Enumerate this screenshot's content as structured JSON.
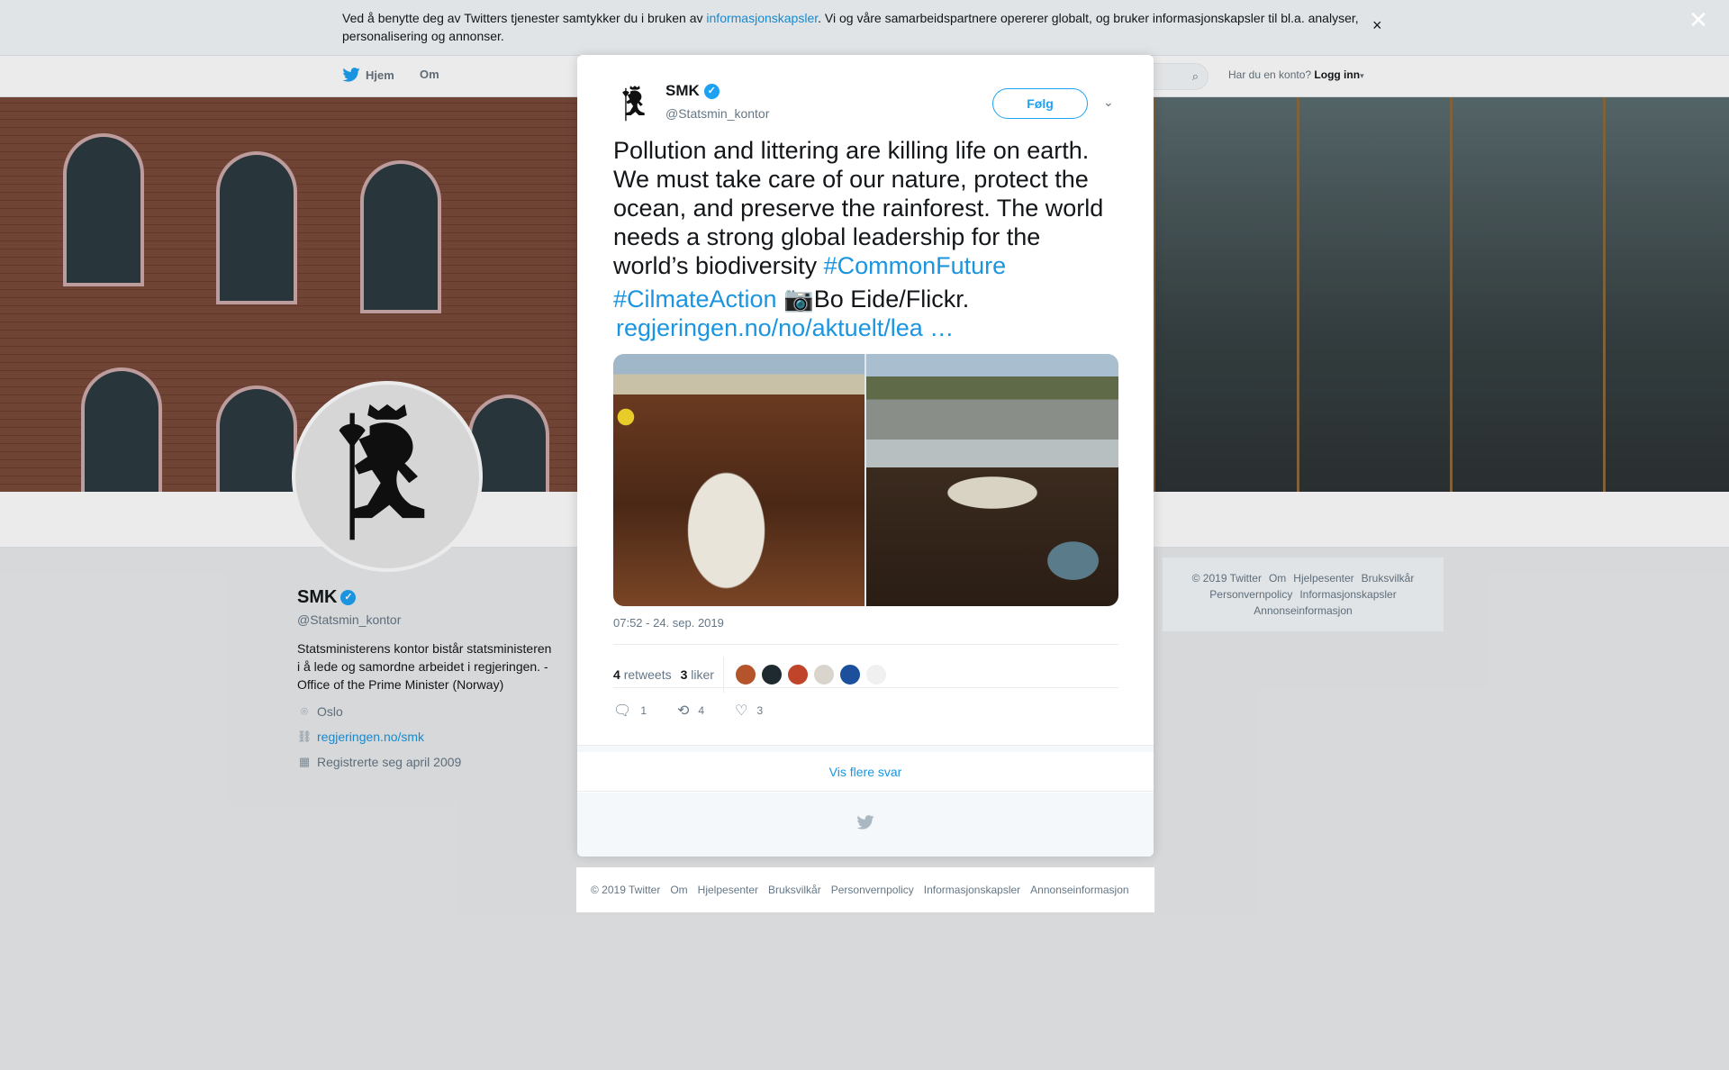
{
  "cookie": {
    "text_before": "Ved å benytte deg av Twitters tjenester samtykker du i bruken av ",
    "link": "informasjonskapsler",
    "text_after": ". Vi og våre samarbeidspartnere opererer globalt, og bruker informasjonskapsler til bl.a. analyser, personalisering og annonser.",
    "close": "×"
  },
  "nav": {
    "home": "Hjem",
    "about": "Om",
    "account_prompt": "Har du en konto?",
    "login": "Logg inn"
  },
  "profile": {
    "name": "SMK",
    "handle": "@Statsmin_kontor",
    "bio": "Statsministerens kontor bistår statsministeren i å lede og samordne arbeidet i regjeringen. - Office of the Prime Minister (Norway)",
    "location": "Oslo",
    "website": "regjeringen.no/smk",
    "joined": "Registrerte seg april 2009"
  },
  "side_footer": {
    "line1": [
      "© 2019 Twitter",
      "Om",
      "Hjelpesenter",
      "Bruksvilkår"
    ],
    "line2": [
      "Personvernpolicy",
      "Informasjonskapsler"
    ],
    "line3": [
      "Annonseinformasjon"
    ]
  },
  "overlay": {
    "close": "✕"
  },
  "tweet": {
    "name": "SMK",
    "handle": "@Statsmin_kontor",
    "follow": "Følg",
    "text": "Pollution and littering are killing life on earth. We must take care of our nature, protect the ocean, and preserve the rainforest. The world needs a strong global leadership for the world’s biodiversity ",
    "hashtag1": "#CommonFuture",
    "hashtag2": "#CilmateAction",
    "camera": "📷",
    "credit": "Bo Eide/Flickr.",
    "link": "regjeringen.no/no/aktuelt/lea …",
    "time": "07:52 - 24. sep. 2019",
    "retweets_count": "4",
    "retweets_label": "retweets",
    "likes_count": "3",
    "likes_label": "liker",
    "likers": [
      "#b5532a",
      "#1f2a30",
      "#c0442a",
      "#d9d4cc",
      "#1c4f9c",
      "#f0f0f0"
    ],
    "replies": "1",
    "retweets": "4",
    "likes": "3",
    "more_replies": "Vis flere svar"
  },
  "modal_footer": [
    "© 2019 Twitter",
    "Om",
    "Hjelpesenter",
    "Bruksvilkår",
    "Personvernpolicy",
    "Informasjonskapsler",
    "Annonseinformasjon"
  ],
  "colors": {
    "accent": "#1da1f2",
    "link": "#1b95e0"
  }
}
